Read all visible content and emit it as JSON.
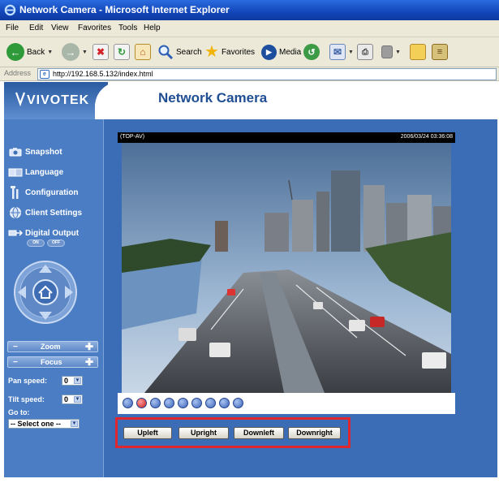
{
  "window": {
    "title": "Network Camera - Microsoft Internet Explorer"
  },
  "menu": {
    "items": [
      "File",
      "Edit",
      "View",
      "Favorites",
      "Tools",
      "Help"
    ]
  },
  "toolbar": {
    "back_label": "Back",
    "search_label": "Search",
    "favorites_label": "Favorites",
    "media_label": "Media"
  },
  "address": {
    "label": "Address",
    "url": "http://192.168.5.132/index.html"
  },
  "header": {
    "logo": "VIVOTEK",
    "title": "Network Camera"
  },
  "sidebar": {
    "items": [
      {
        "label": "Snapshot",
        "icon": "camera-icon"
      },
      {
        "label": "Language",
        "icon": "language-icon"
      },
      {
        "label": "Configuration",
        "icon": "wrench-icon"
      },
      {
        "label": "Client Settings",
        "icon": "globe-icon"
      },
      {
        "label": "Digital Output",
        "icon": "output-icon"
      }
    ],
    "output_on": "ON",
    "output_off": "OFF",
    "zoom_label": "Zoom",
    "focus_label": "Focus",
    "pan_speed_label": "Pan speed:",
    "pan_speed_value": "0",
    "tilt_speed_label": "Tilt speed:",
    "tilt_speed_value": "0",
    "goto_label": "Go to:",
    "goto_value": "-- Select one --"
  },
  "video": {
    "camera_name": "(TOP-AV)",
    "timestamp": "2006/03/24 03:36:08"
  },
  "ptz_buttons": [
    "Upleft",
    "Upright",
    "Downleft",
    "Downright"
  ],
  "colors": {
    "highlight": "#e0262e",
    "page_blue": "#3d70b8",
    "title_blue": "#1f4e93"
  }
}
